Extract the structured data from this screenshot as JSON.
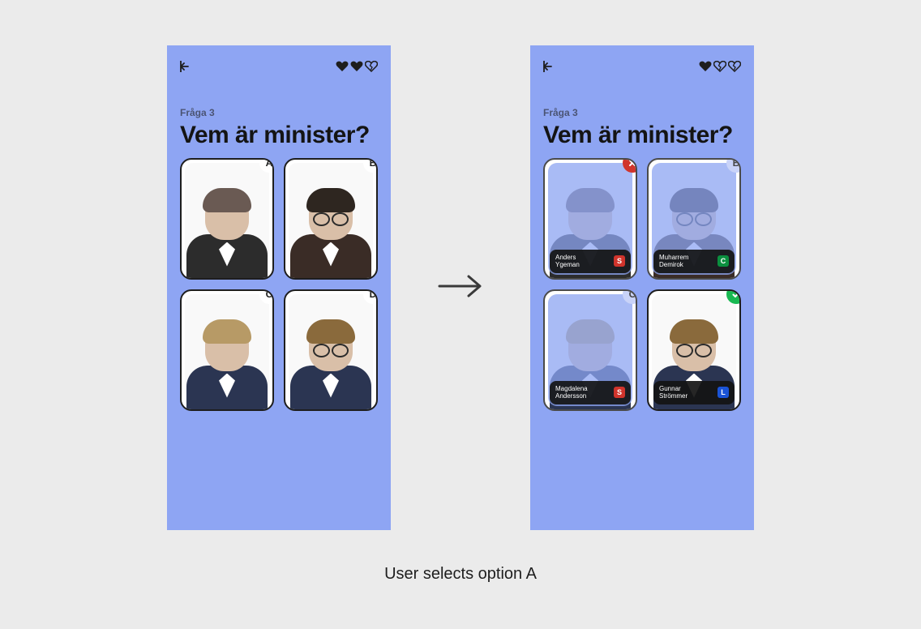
{
  "caption": "User selects option A",
  "question": {
    "label": "Fråga 3",
    "title": "Vem är minister?"
  },
  "screens": {
    "before": {
      "hearts": [
        "full",
        "full",
        "broken"
      ],
      "options": [
        {
          "letter": "A"
        },
        {
          "letter": "B"
        },
        {
          "letter": "C"
        },
        {
          "letter": "D"
        }
      ]
    },
    "after": {
      "hearts": [
        "full",
        "broken",
        "broken"
      ],
      "options": [
        {
          "state": "wrong",
          "name_line1": "Anders",
          "name_line2": "Ygeman",
          "party_letter": "S",
          "party_color": "#d0342c"
        },
        {
          "state": "dim",
          "letter": "B",
          "name_line1": "Muharrem",
          "name_line2": "Demirok",
          "party_letter": "C",
          "party_color": "#0b8f3f"
        },
        {
          "state": "dim",
          "letter": "C",
          "name_line1": "Magdalena",
          "name_line2": "Andersson",
          "party_letter": "S",
          "party_color": "#d0342c"
        },
        {
          "state": "correct",
          "name_line1": "Gunnar",
          "name_line2": "Strömmer",
          "party_letter": "L",
          "party_color": "#1a53d6"
        }
      ]
    }
  },
  "portrait_styles": [
    {
      "hair": "#6a5a53",
      "suit": "#2c2c2c",
      "glasses": false
    },
    {
      "hair": "#2e2620",
      "suit": "#3a2c26",
      "glasses": true
    },
    {
      "hair": "#b79a66",
      "suit": "#2b3552",
      "glasses": false
    },
    {
      "hair": "#8a6a3c",
      "suit": "#2b3552",
      "glasses": true
    }
  ]
}
